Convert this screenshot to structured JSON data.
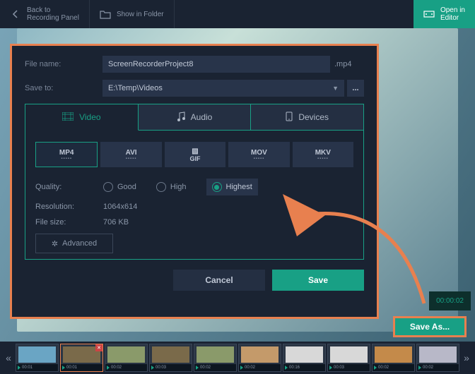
{
  "topbar": {
    "back": "Back to\nRecording Panel",
    "folder": "Show in Folder",
    "editor": "Open in\nEditor"
  },
  "dialog": {
    "filename_label": "File name:",
    "filename": "ScreenRecorderProject8",
    "ext": ".mp4",
    "saveto_label": "Save to:",
    "saveto": "E:\\Temp\\Videos",
    "tabs": {
      "video": "Video",
      "audio": "Audio",
      "devices": "Devices"
    },
    "formats": [
      "MP4",
      "AVI",
      "GIF",
      "MOV",
      "MKV"
    ],
    "quality_label": "Quality:",
    "quality": {
      "good": "Good",
      "high": "High",
      "highest": "Highest"
    },
    "resolution_label": "Resolution:",
    "resolution": "1064x614",
    "filesize_label": "File size:",
    "filesize": "706 KB",
    "advanced": "Advanced",
    "cancel": "Cancel",
    "save": "Save"
  },
  "timecode": "00:00:02",
  "saveas": "Save As...",
  "thumbs": [
    "00:01",
    "00:01",
    "00:02",
    "00:03",
    "00:02",
    "00:02",
    "00:16",
    "00:03",
    "00:02",
    "00:02"
  ]
}
